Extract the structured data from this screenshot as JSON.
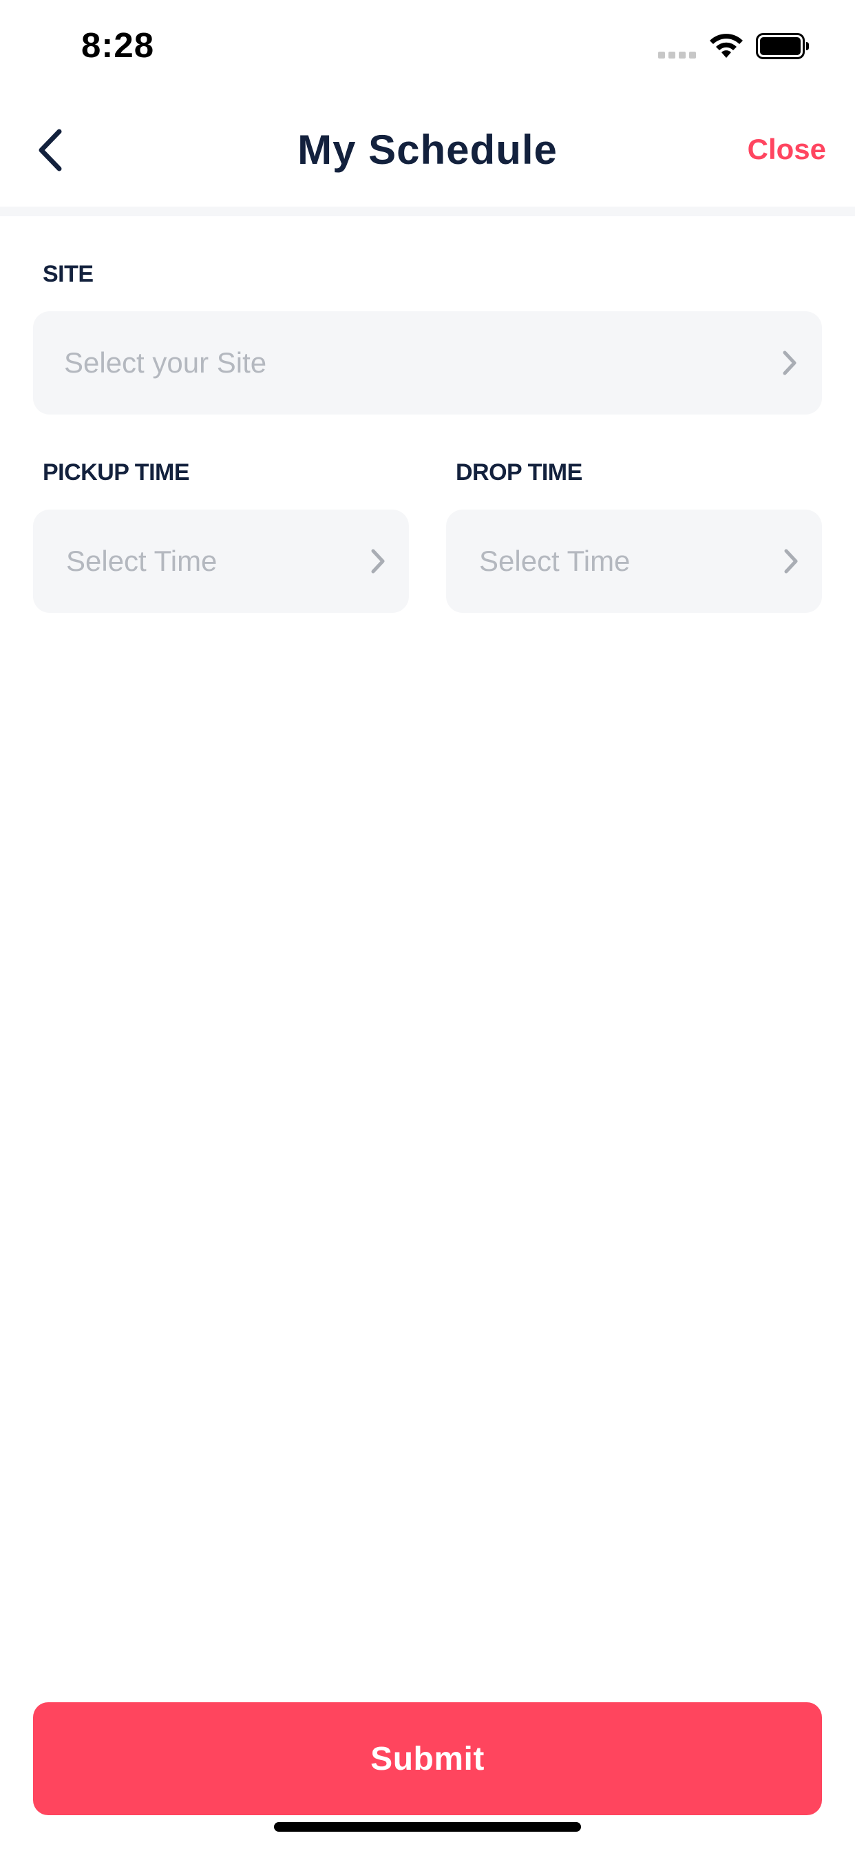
{
  "status_bar": {
    "time": "8:28"
  },
  "nav": {
    "title": "My Schedule",
    "close_label": "Close",
    "back_icon": "chevron-left-icon"
  },
  "form": {
    "site": {
      "label": "SITE",
      "placeholder": "Select your Site"
    },
    "pickup_time": {
      "label": "PICKUP TIME",
      "placeholder": "Select Time"
    },
    "drop_time": {
      "label": "DROP TIME",
      "placeholder": "Select Time"
    }
  },
  "submit_label": "Submit",
  "colors": {
    "accent": "#ff455e",
    "title_text": "#13213d",
    "field_background": "#f5f6f8",
    "placeholder_text": "#b4b8bf"
  }
}
